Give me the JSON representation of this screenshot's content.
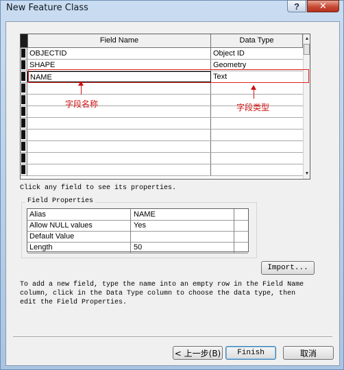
{
  "window": {
    "title": "New Feature Class",
    "help_glyph": "?",
    "close_glyph": "✕"
  },
  "grid": {
    "columns": [
      "Field Name",
      "Data Type"
    ],
    "rows": [
      {
        "name": "OBJECTID",
        "type": "Object ID"
      },
      {
        "name": "SHAPE",
        "type": "Geometry"
      },
      {
        "name": "NAME",
        "type": "Text"
      }
    ],
    "empty_rows": 9,
    "scroll_up": "▲",
    "scroll_down": "▼"
  },
  "annotations": {
    "field_name_label": "字段名称",
    "data_type_label": "字段类型"
  },
  "hint_top": "Click any field to see its properties.",
  "field_properties": {
    "title": "Field Properties",
    "rows": [
      {
        "key": "Alias",
        "value": "NAME"
      },
      {
        "key": "Allow NULL values",
        "value": "Yes"
      },
      {
        "key": "Default Value",
        "value": ""
      },
      {
        "key": "Length",
        "value": "50"
      }
    ]
  },
  "import_label": "Import...",
  "instructions": [
    "To add a new field, type the name into an empty row in the Field Name",
    "column, click in the Data Type column to choose the data type, then",
    "edit the Field Properties."
  ],
  "buttons": {
    "back": "< 上一步(B)",
    "finish": "Finish",
    "cancel": "取消"
  },
  "colors": {
    "annotation": "#d01010",
    "close": "#c74a35"
  }
}
